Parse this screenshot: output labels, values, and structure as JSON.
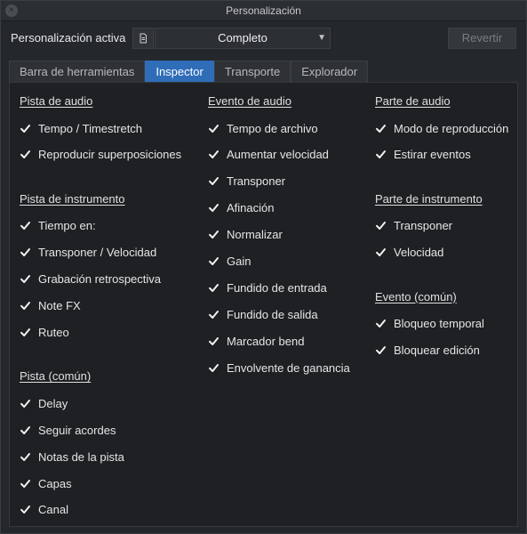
{
  "window": {
    "title": "Personalización",
    "close_glyph": "×"
  },
  "toolbar": {
    "active_label": "Personalización activa",
    "selected_profile": "Completo",
    "revert_label": "Revertir",
    "doc_icon": "document-icon",
    "caret_icon": "chevron-down-icon"
  },
  "tabs": [
    {
      "label": "Barra de herramientas",
      "active": false
    },
    {
      "label": "Inspector",
      "active": true
    },
    {
      "label": "Transporte",
      "active": false
    },
    {
      "label": "Explorador",
      "active": false
    }
  ],
  "colors": {
    "accent": "#2f6db8",
    "background": "#1e2024",
    "text": "#e6e6e6"
  },
  "columns": [
    {
      "sections": [
        {
          "title": "Pista de audio",
          "items": [
            "Tempo / Timestretch",
            "Reproducir superposiciones"
          ]
        },
        {
          "title": "Pista de instrumento",
          "items": [
            "Tiempo en:",
            "Transponer / Velocidad",
            "Grabación retrospectiva",
            "Note FX",
            "Ruteo"
          ]
        },
        {
          "title": "Pista (común)",
          "items": [
            "Delay",
            "Seguir acordes",
            "Notas de la pista",
            "Capas",
            "Canal"
          ]
        }
      ]
    },
    {
      "sections": [
        {
          "title": "Evento de audio",
          "items": [
            "Tempo de archivo",
            "Aumentar velocidad",
            "Transponer",
            "Afinación",
            "Normalizar",
            "Gain",
            "Fundido de entrada",
            "Fundido de salida",
            "Marcador bend",
            "Envolvente de ganancia"
          ]
        }
      ]
    },
    {
      "sections": [
        {
          "title": "Parte de audio",
          "items": [
            "Modo de reproducción",
            "Estirar eventos"
          ]
        },
        {
          "title": "Parte de instrumento",
          "items": [
            "Transponer",
            "Velocidad"
          ]
        },
        {
          "title": "Evento (común)",
          "items": [
            "Bloqueo temporal",
            "Bloquear edición"
          ]
        }
      ]
    }
  ]
}
